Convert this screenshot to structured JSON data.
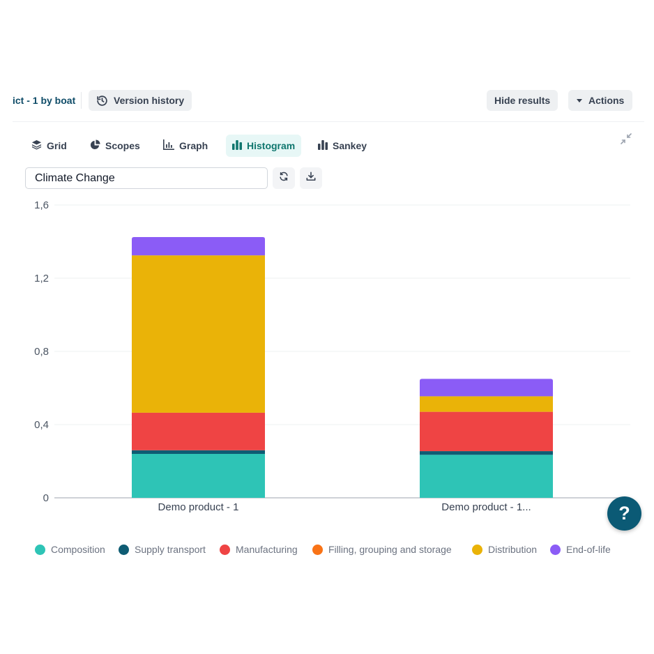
{
  "header": {
    "breadcrumb": "ict - 1 by boat",
    "version_history_label": "Version history",
    "hide_results_label": "Hide results",
    "actions_label": "Actions"
  },
  "tabs": [
    {
      "label": "Grid",
      "icon": "layers-icon",
      "active": false
    },
    {
      "label": "Scopes",
      "icon": "pie-chart-icon",
      "active": false
    },
    {
      "label": "Graph",
      "icon": "graph-icon",
      "active": false
    },
    {
      "label": "Histogram",
      "icon": "bar-chart-icon",
      "active": true
    },
    {
      "label": "Sankey",
      "icon": "sankey-icon",
      "active": false
    }
  ],
  "impact_select": {
    "value": "Climate Change"
  },
  "help": {
    "label": "?"
  },
  "colors": {
    "accent": "#0f766e",
    "brand": "#0b5a75",
    "Composition": "#2ec4b6",
    "Supply transport": "#0e5c73",
    "Manufacturing": "#ef4444",
    "Filling, grouping and storage": "#f97316",
    "Distribution": "#eab308",
    "End-of-life": "#8b5cf6"
  },
  "chart_data": {
    "type": "bar",
    "stacked": true,
    "categories": [
      "Demo product - 1",
      "Demo product - 1..."
    ],
    "series": [
      {
        "name": "Composition",
        "values": [
          0.24,
          0.235
        ]
      },
      {
        "name": "Supply transport",
        "values": [
          0.02,
          0.02
        ]
      },
      {
        "name": "Manufacturing",
        "values": [
          0.205,
          0.215
        ]
      },
      {
        "name": "Filling, grouping and storage",
        "values": [
          0,
          0
        ]
      },
      {
        "name": "Distribution",
        "values": [
          0.86,
          0.085
        ]
      },
      {
        "name": "End-of-life",
        "values": [
          0.1,
          0.095
        ]
      }
    ],
    "ylim": [
      0,
      1.6
    ],
    "yticks": [
      "0",
      "0,4",
      "0,8",
      "1,2",
      "1,6"
    ],
    "ytick_values": [
      0,
      0.4,
      0.8,
      1.2,
      1.6
    ],
    "grid": true,
    "legend": "bottom"
  }
}
